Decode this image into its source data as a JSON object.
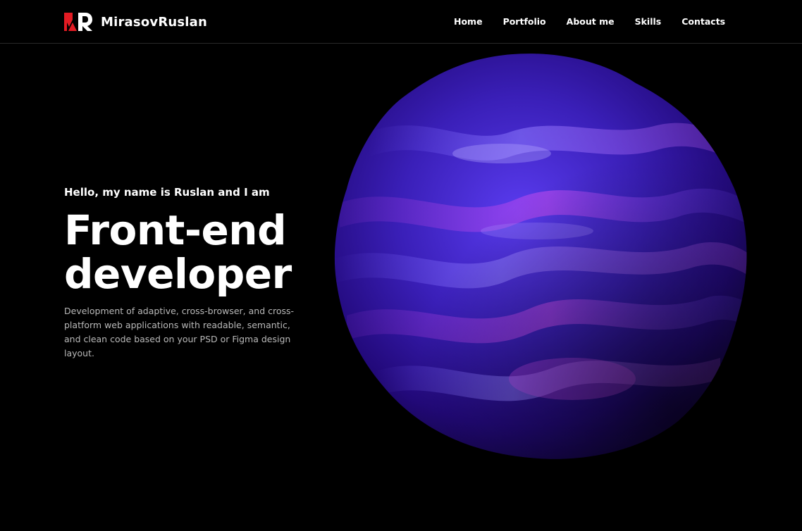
{
  "brand": {
    "name": "MirasovRuslan",
    "logo_colors": {
      "m_mark": "#e31b23",
      "r_mark": "#ffffff"
    }
  },
  "nav": {
    "items": [
      {
        "label": "Home"
      },
      {
        "label": "Portfolio"
      },
      {
        "label": "About me"
      },
      {
        "label": "Skills"
      },
      {
        "label": "Contacts"
      }
    ]
  },
  "hero": {
    "greeting": "Hello, my name is Ruslan and  I am",
    "title_line1": "Front-end",
    "title_line2": "developer",
    "description": "Development of adaptive, cross-browser, and cross-platform web applications with readable, semantic, and clean code based on your PSD or Figma design layout."
  },
  "colors": {
    "background": "#000000",
    "text": "#ffffff",
    "muted_text": "#b9b9b9",
    "blob_dark": "#2a0b6e",
    "blob_mid": "#4a2cd6",
    "blob_highlight": "#c040e8"
  }
}
